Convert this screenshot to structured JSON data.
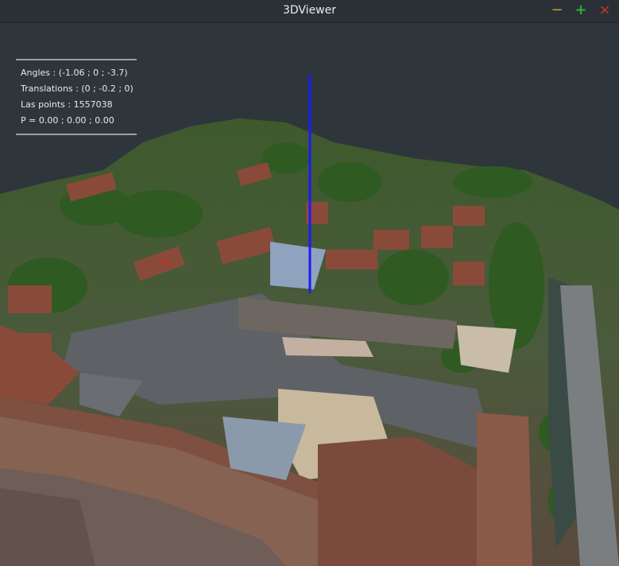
{
  "window": {
    "title": "3DViewer",
    "controls": {
      "minimize": "−",
      "maximize": "+",
      "close": "×"
    }
  },
  "info": {
    "angles": "Angles : (-1.06 ; 0 ; -3.7)",
    "translations": "Translations : (0 ; -0.2 ; 0)",
    "las_points": "Las points : 1557038",
    "p": "P = 0.00 ; 0.00 ; 0.00"
  },
  "colors": {
    "background": "#2f363b",
    "axis_line": "#1a1aff",
    "minimize": "#c9a227",
    "maximize": "#2fae3a",
    "close": "#c0392b"
  }
}
